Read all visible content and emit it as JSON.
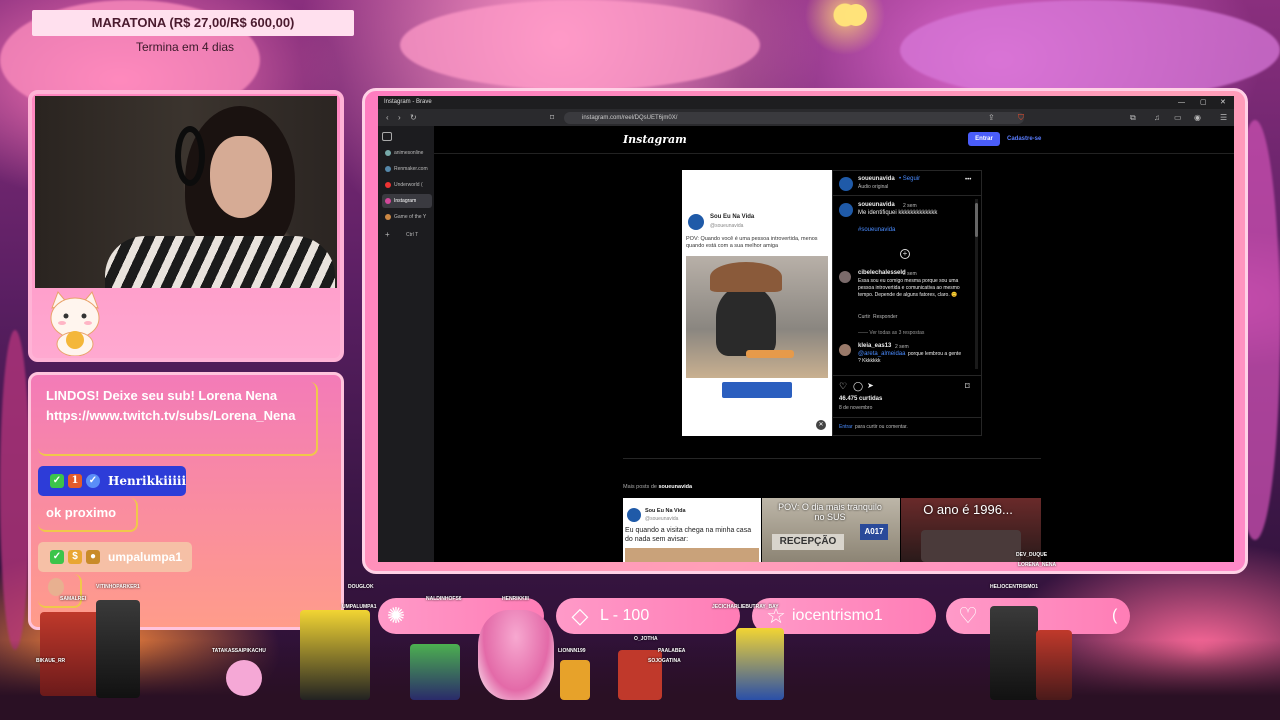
{
  "marathon": {
    "title": "MARATONA (R$ 27,00/R$ 600,00)",
    "subtitle": "Termina em 4 dias"
  },
  "chat": {
    "messages": [
      {
        "text": "LINDOS! Deixe seu sub! Lorena Nena https://www.twitch.tv/subs/Lorena_Nena"
      },
      {
        "user": "Henrikkiiiii",
        "text": "ok proximo"
      },
      {
        "user": "umpalumpa1",
        "text": ""
      }
    ]
  },
  "browser": {
    "window_title": "Instagram - Brave",
    "url": "instagram.com/reel/DQsUET6jm0X/",
    "tabs": [
      {
        "label": "animesonline"
      },
      {
        "label": "Renmaker.com"
      },
      {
        "label": "Underworld ("
      },
      {
        "label": "Instagram"
      },
      {
        "label": "Game of the Y"
      },
      {
        "label": "Ctrl T"
      }
    ]
  },
  "instagram": {
    "logo": "Instagram",
    "login_button": "Entrar",
    "signup_link": "Cadastre-se",
    "post_header_name": "Sou Eu Na Vida",
    "post_header_handle": "@soueunavida",
    "post_caption": "POV: Quando você é uma pessoa introvertida, menos quando está com a sua melhor amiga",
    "author": "soueunavida",
    "follow": "• Seguir",
    "audio": "Áudio original",
    "author_comment_time": "2 sem",
    "author_comment": "Me identifiquei kkkkkkkkkkkkk",
    "hashtag": "#soueunavida",
    "comments": [
      {
        "user": "cibelechalesseld",
        "time": "2 sem",
        "text": "Essa sou eu comigo mesma porque sou uma pessoa introvertida e comunicativa ao mesmo tempo. Depende de alguns fatores, claro. 😊",
        "like": "Curtir",
        "reply": "Responder",
        "more": "Ver todas as 3 respostas"
      },
      {
        "user": "kleia_eas13",
        "time": "2 sem",
        "mention": "@areta_almeidaa",
        "text": "porque lembrou a gente ? Kkkkkkk"
      }
    ],
    "likes": "46.475 curtidas",
    "date": "8 de novembro",
    "login_prompt_link": "Entrar",
    "login_prompt_text": "para curtir ou comentar.",
    "more_posts_label": "Mais posts de",
    "more_posts_user": "soueunavida",
    "thumbs": [
      {
        "name": "Sou Eu Na Vida",
        "handle": "@soueunavida",
        "text": "Eu quando a visita chega na minha casa do nada sem avisar:"
      },
      {
        "text": "POV: O dia mais tranquilo no SUS",
        "sign": "RECEPÇÃO",
        "ticket": "A017"
      },
      {
        "text": "O ano é 1996..."
      }
    ]
  },
  "bottom_bar": {
    "pill_text_1": "L - 100",
    "pill_text_2": "iocentrismo1",
    "pill_text_3": "("
  },
  "name_tags": [
    "VITINHOPARKER1",
    "SAMALREI",
    "BIKAUE_RR",
    "DOUGLOK",
    "UMPALUMPA1",
    "NALDINHOFS6",
    "HENRIKKIII",
    "TATAKASSAIPIKACHU",
    "LIONNN199",
    "O_JOTHA",
    "PAALABEA",
    "SOJOGATINA",
    "JECICHARLIEBUTRAY_BAY",
    "HELIOCENTRISMO1",
    "DEV_DUQUE",
    "LORENA_NENA"
  ],
  "colors": {
    "accent_pink": "#ff7db6",
    "instagram_blue": "#4a5df9",
    "twitch_badge_blue": "#2d3cd8",
    "chat_border_gold": "#f0c84a"
  }
}
